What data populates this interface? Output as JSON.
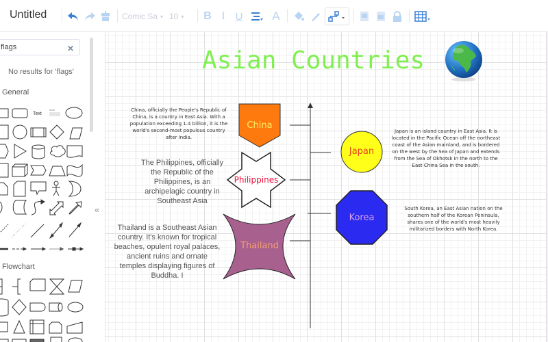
{
  "toolbar": {
    "title": "Untitled",
    "font_name": "Comic Sa",
    "font_size": "10",
    "icons": [
      "undo-icon",
      "redo-icon",
      "format-painter-icon",
      "bold-icon",
      "italic-icon",
      "underline-icon",
      "align-icon",
      "font-color-icon",
      "fill-color-icon",
      "line-color-icon",
      "connector-style-icon",
      "to-front-icon",
      "to-back-icon",
      "lock-icon",
      "table-icon"
    ]
  },
  "sidebar": {
    "search_value": "flags",
    "no_results": "No results for 'flags'",
    "sections": [
      {
        "title": "General"
      },
      {
        "title": "Flowchart"
      }
    ],
    "text_shape_label": "Text",
    "collapse_glyph": "«"
  },
  "canvas": {
    "title": "Asian Countries",
    "colors": {
      "title": "#7ff050",
      "china_fill": "#ff7a0e",
      "china_text": "#ffee66",
      "philippines_fill": "#ffffff",
      "philippines_text": "#e8103a",
      "thailand_fill": "#a8618f",
      "thailand_text": "#f4a070",
      "japan_fill": "#ffff1a",
      "japan_text": "#e8401a",
      "korea_fill": "#2a2af0",
      "korea_text": "#d8a0f0"
    },
    "countries": {
      "china": {
        "name": "China",
        "description": "China, officially the People's Republic of China, is a country in East Asia. With a population exceeding 1.4 billion, it is the world's second-most populous country after India."
      },
      "philippines": {
        "name": "Philippines",
        "description": "The Philippines, officially the Republic of the Philippines, is an archipelagic country in Southeast Asia"
      },
      "thailand": {
        "name": "Thailand",
        "description": "Thailand is a Southeast Asian country. It's known for tropical beaches, opulent royal palaces, ancient ruins and ornate temples displaying figures of Buddha. I"
      },
      "japan": {
        "name": "Japan",
        "description": "Japan is an island country in East Asia. It is located in the Pacific Ocean off the northeast coast of the Asian mainland, and is bordered on the west by the Sea of Japan and extends from the Sea of Okhotsk in the north to the East China Sea in the south."
      },
      "korea": {
        "name": "Korea",
        "description": "South Korea, an East Asian nation on the southern half of the Korean Peninsula, shares one of the world's most heavily militarized borders with North Korea."
      }
    }
  }
}
